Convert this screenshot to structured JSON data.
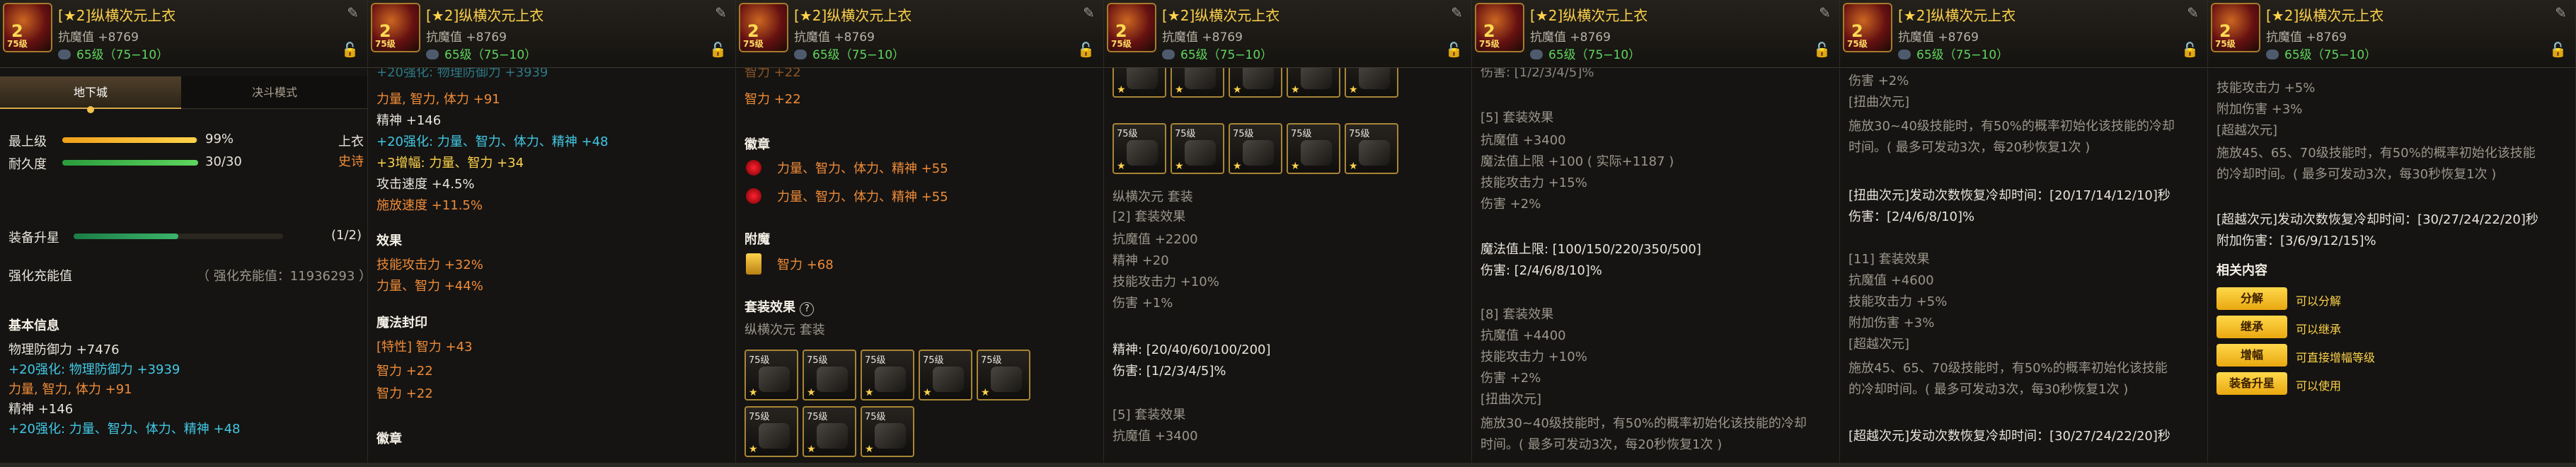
{
  "header": {
    "item_name": "[★2]纵横次元上衣",
    "power": "抗魔值 +8769",
    "level": "65级（75−10）",
    "edit_icon": "edit-icon",
    "lock_icon": "lock-icon",
    "icon_rank": "2",
    "icon_level": "75级"
  },
  "p1": {
    "tab_dungeon": "地下城",
    "tab_duel": "决斗模式",
    "max_grade_label": "最上级",
    "max_grade_pct": "99%",
    "max_grade_value": 0.99,
    "slot_label": "上衣",
    "durability_label": "耐久度",
    "durability_value": "30/30",
    "durability_fraction": 1.0,
    "rarity": "史诗",
    "upgrade_label": "装备升星",
    "upgrade_count": "(1/2)",
    "upgrade_fraction": 0.5,
    "reinforce_label": "强化充能值",
    "reinforce_value": "（ 强化充能值：11936293 ）",
    "basic_info": "基本信息",
    "phys_def": "物理防御力 +7476",
    "enh1": "+20强化: 物理防御力 +3939",
    "str": "力量, 智力, 体力 +91",
    "spirit": "精神 +146",
    "enh2": "+20强化: 力量、智力、体力、精神 +48"
  },
  "p2": {
    "cut_top": "+20强化: 物理防御力 +3939",
    "str": "力量, 智力, 体力 +91",
    "spirit": "精神 +146",
    "enh": "+20强化: 力量、智力、体力、精神 +48",
    "amp": "+3增幅: 力量、智力 +34",
    "atk_speed": "攻击速度 +4.5%",
    "cast_speed": "施放速度 +11.5%",
    "effect_title": "效果",
    "skill_atk": "技能攻击力 +32%",
    "stat_pct": "力量、智力 +44%",
    "seal_title": "魔法封印",
    "seal1": "[特性] 智力 +43",
    "seal2": "智力 +22",
    "seal3": "智力 +22",
    "emblem_title": "徽章"
  },
  "p3": {
    "cut_top": "智力 +22",
    "int": "智力 +22",
    "emblem_title": "徽章",
    "emblem1": "力量、智力、体力、精神 +55",
    "emblem2": "力量、智力、体力、精神 +55",
    "enchant_title": "附魔",
    "enchant": "智力 +68",
    "set_title": "套装效果",
    "help_icon": "?",
    "set_name": "纵横次元 套装"
  },
  "p4": {
    "set_name": "纵横次元 套装",
    "set2": "[2] 套装效果",
    "mp": "抗魔值 +2200",
    "spirit": "精神 +20",
    "skill_atk": "技能攻击力 +10%",
    "dmg": "伤害 +1%",
    "spirit_tiers": "精神: [20/40/60/100/200]",
    "dmg_tiers": "伤害: [1/2/3/4/5]%",
    "set5": "[5] 套装效果",
    "mp5": "抗魔值 +3400"
  },
  "p5": {
    "cut_top": "伤害: [1/2/3/4/5]%",
    "set5": "[5] 套装效果",
    "mp": "抗魔值 +3400",
    "mp_limit": "魔法值上限 +100 ( 实际+1187 )",
    "skill_atk": "技能攻击力 +15%",
    "dmg": "伤害 +2%",
    "mp_tiers": "魔法值上限: [100/150/220/350/500]",
    "dmg_tiers": "伤害: [2/4/6/8/10]%",
    "set8": "[8] 套装效果",
    "mp8": "抗魔值 +4400",
    "skill_atk8": "技能攻击力 +10%",
    "dmg8": "伤害 +2%",
    "twist": "[扭曲次元]",
    "twist_desc1": "施放30~40级技能时，有50%的概率初始化该技能的冷却",
    "twist_desc2": "时间。( 最多可发动3次，每20秒恢复1次 )"
  },
  "p6": {
    "dmg": "伤害 +2%",
    "twist": "[扭曲次元]",
    "twist_desc1": "施放30~40级技能时，有50%的概率初始化该技能的冷却",
    "twist_desc2": "时间。( 最多可发动3次，每20秒恢复1次 )",
    "twist_cd": "[扭曲次元]发动次数恢复冷却时间：[20/17/14/12/10]秒",
    "twist_dmg": "伤害：[2/4/6/8/10]%",
    "set11": "[11] 套装效果",
    "mp": "抗魔值 +4600",
    "skill_atk": "技能攻击力 +5%",
    "extra_dmg": "附加伤害 +3%",
    "over": "[超越次元]",
    "over_desc1": "施放45、65、70级技能时，有50%的概率初始化该技能",
    "over_desc2": "的冷却时间。( 最多可发动3次，每30秒恢复1次 )",
    "over_cd": "[超越次元]发动次数恢复冷却时间：[30/27/24/22/20]秒"
  },
  "p7": {
    "skill_atk": "技能攻击力 +5%",
    "extra_dmg": "附加伤害 +3%",
    "over": "[超越次元]",
    "over_desc1": "施放45、65、70级技能时，有50%的概率初始化该技能",
    "over_desc2": "的冷却时间。( 最多可发动3次，每30秒恢复1次 )",
    "over_cd": "[超越次元]发动次数恢复冷却时间：[30/27/24/22/20]秒",
    "over_dmg": "附加伤害：[3/6/9/12/15]%",
    "related": "相关内容",
    "btn1": "分解",
    "link1": "可以分解",
    "btn2": "继承",
    "link2": "可以继承",
    "btn3": "增幅",
    "link3": "可直接增幅等级",
    "btn4": "装备升星",
    "link4": "可以使用"
  },
  "slot_tag": "75级",
  "slot_star": "★",
  "colors": {
    "gold": "#ffd34a",
    "orange": "#f08b38",
    "cyan": "#42c8e4",
    "green": "#5fd65f"
  }
}
